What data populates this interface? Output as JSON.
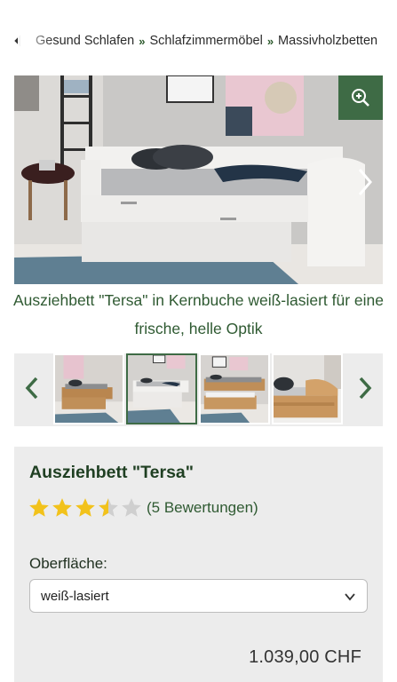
{
  "breadcrumb": {
    "items": [
      "Gesund Schlafen",
      "Schlafzimmermöbel",
      "Massivholzbetten"
    ],
    "separator": "»"
  },
  "hero": {
    "caption": "Ausziehbett \"Tersa\" in Kernbuche weiß-lasiert für eine frische, helle Optik",
    "zoom_icon": "zoom-in-icon",
    "next_icon": "chevron-right-icon"
  },
  "thumbnails": {
    "count": 4,
    "active_index": 1,
    "prev_icon": "chevron-left-icon",
    "next_icon": "chevron-right-icon"
  },
  "product": {
    "title": "Ausziehbett \"Tersa\"",
    "rating": 3.5,
    "rating_max": 5,
    "reviews_label": "(5 Bewertungen)",
    "surface_label": "Oberfläche:",
    "surface_selected": "weiß-lasiert",
    "price": "1.039,00 CHF"
  },
  "colors": {
    "brand_green": "#3e6b45",
    "text_green": "#2f5a32",
    "star_gold": "#f2c21b",
    "star_empty": "#cfcfcf",
    "panel_bg": "#ececec"
  }
}
